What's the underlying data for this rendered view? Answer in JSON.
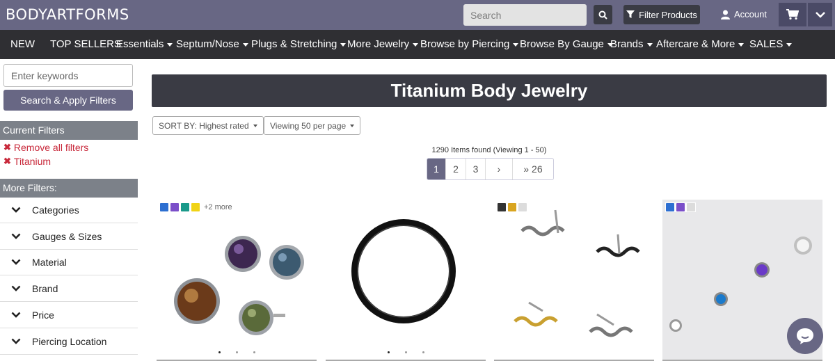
{
  "header": {
    "logo": "BODYARTFORMS",
    "search_placeholder": "Search",
    "filter_label": "Filter Products",
    "account_label": "Account"
  },
  "nav": {
    "items": [
      {
        "label": "NEW"
      },
      {
        "label": "TOP SELLERS"
      },
      {
        "label": "Essentials"
      },
      {
        "label": "Septum/Nose"
      },
      {
        "label": "Plugs & Stretching"
      },
      {
        "label": "More Jewelry"
      },
      {
        "label": "Browse by Piercing"
      },
      {
        "label": "Browse By Gauge"
      },
      {
        "label": "Brands"
      },
      {
        "label": "Aftercare & More"
      },
      {
        "label": "SALES"
      }
    ]
  },
  "sidebar": {
    "keyword_placeholder": "Enter keywords",
    "apply_label": "Search & Apply Filters",
    "current_filters_title": "Current Filters",
    "current_filters": [
      "Remove all filters",
      "Titanium"
    ],
    "more_filters_title": "More Filters:",
    "more_filters": [
      "Categories",
      "Gauges & Sizes",
      "Material",
      "Brand",
      "Price",
      "Piercing Location"
    ]
  },
  "main": {
    "title": "Titanium Body Jewelry",
    "sort_label": "SORT BY: Highest rated",
    "view_label": "Viewing 50 per page",
    "found_text": "1290 Items found (Viewing 1 - 50)",
    "pages": [
      "1",
      "2",
      "3",
      "›",
      "» 26"
    ],
    "active_page": "1"
  },
  "products": [
    {
      "swatches": [
        "#2d6fd1",
        "#7b4fc9",
        "#1a9a8a",
        "#f0d316"
      ],
      "more": "+2 more",
      "dots": 3,
      "active_dot": 0
    },
    {
      "swatches": [],
      "more": "",
      "dots": 3,
      "active_dot": 0
    },
    {
      "swatches": [
        "#333333",
        "#d9a520",
        "#dcdcdc"
      ],
      "more": "",
      "dots": 0,
      "active_dot": 0
    },
    {
      "swatches": [
        "#2d6fd1",
        "#7b4fc9",
        "#dcdcdc"
      ],
      "more": "",
      "dots": 0,
      "active_dot": 0
    }
  ],
  "colors": {
    "brand": "#686784",
    "nav_bg": "#2f2f33",
    "filter_red": "#c8283a"
  }
}
